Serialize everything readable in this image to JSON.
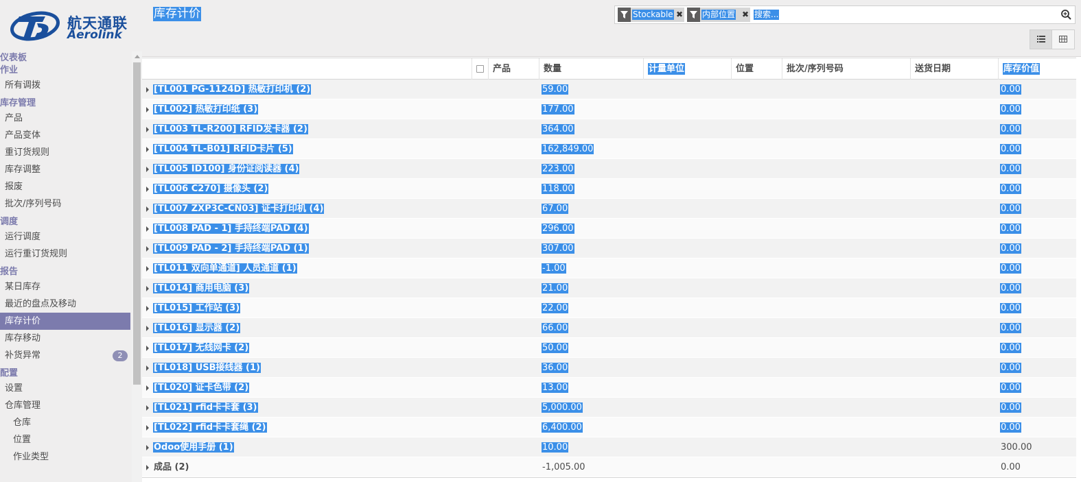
{
  "brand": {
    "name_cn": "航天通联",
    "name_en": "Aerolink",
    "colors": {
      "logo": "#1a4f9c",
      "accent": "#7c7bad",
      "selection": "#3b8fe8"
    }
  },
  "sidebar": {
    "sections": [
      {
        "header": "仪表板",
        "items": []
      },
      {
        "header": "作业",
        "items": [
          {
            "label": "所有调拨"
          }
        ]
      },
      {
        "header": "库存管理",
        "items": [
          {
            "label": "产品"
          },
          {
            "label": "产品变体"
          },
          {
            "label": "重订货规则"
          },
          {
            "label": "库存调整"
          },
          {
            "label": "报废"
          },
          {
            "label": "批次/序列号码"
          }
        ]
      },
      {
        "header": "调度",
        "items": [
          {
            "label": "运行调度"
          },
          {
            "label": "运行重订货规则"
          }
        ]
      },
      {
        "header": "报告",
        "items": [
          {
            "label": "某日库存"
          },
          {
            "label": "最近的盘点及移动"
          },
          {
            "label": "库存计价"
          },
          {
            "label": "库存移动"
          },
          {
            "label": "补货异常",
            "badge": "2"
          }
        ]
      },
      {
        "header": "配置",
        "items": [
          {
            "label": "设置"
          },
          {
            "label": "仓库管理"
          },
          {
            "label": "仓库"
          },
          {
            "label": "位置"
          },
          {
            "label": "作业类型"
          }
        ]
      }
    ]
  },
  "control_panel": {
    "title": "库存计价",
    "search": {
      "facets": [
        {
          "label": "Stockable",
          "icon": "filter-icon"
        },
        {
          "label": "内部位置",
          "icon": "filter-icon"
        }
      ],
      "placeholder": "搜索..."
    },
    "views": [
      {
        "name": "list-view",
        "icon": "list-icon",
        "active": true
      },
      {
        "name": "pivot-view",
        "icon": "grid-icon",
        "active": false
      }
    ]
  },
  "table": {
    "columns": [
      "产品",
      "数量",
      "计量单位",
      "位置",
      "批次/序列号码",
      "送货日期",
      "库存价值"
    ],
    "rows": [
      {
        "name": "[TL001 PG-1124D] 热敏打印机 (2)",
        "quantity": "59.00",
        "value": "0.00"
      },
      {
        "name": "[TL002] 热敏打印纸 (3)",
        "quantity": "177.00",
        "value": "0.00"
      },
      {
        "name": "[TL003 TL-R200] RFID发卡器 (2)",
        "quantity": "364.00",
        "value": "0.00"
      },
      {
        "name": "[TL004 TL-B01] RFID卡片 (5)",
        "quantity": "162,849.00",
        "value": "0.00"
      },
      {
        "name": "[TL005 ID100] 身份证阅读器 (4)",
        "quantity": "223.00",
        "value": "0.00"
      },
      {
        "name": "[TL006 C270] 摄像头 (2)",
        "quantity": "118.00",
        "value": "0.00"
      },
      {
        "name": "[TL007 ZXP3C-CN03] 证卡打印机 (4)",
        "quantity": "67.00",
        "value": "0.00"
      },
      {
        "name": "[TL008 PAD - 1] 手持终端PAD (4)",
        "quantity": "296.00",
        "value": "0.00"
      },
      {
        "name": "[TL009 PAD - 2] 手持终端PAD (1)",
        "quantity": "307.00",
        "value": "0.00"
      },
      {
        "name": "[TL011 双向单通道] 人员通道 (1)",
        "quantity": "-1.00",
        "value": "0.00"
      },
      {
        "name": "[TL014] 商用电脑 (3)",
        "quantity": "21.00",
        "value": "0.00"
      },
      {
        "name": "[TL015] 工作站 (3)",
        "quantity": "22.00",
        "value": "0.00"
      },
      {
        "name": "[TL016] 显示器 (2)",
        "quantity": "66.00",
        "value": "0.00"
      },
      {
        "name": "[TL017] 无线网卡 (2)",
        "quantity": "50.00",
        "value": "0.00"
      },
      {
        "name": "[TL018] USB接线器 (1)",
        "quantity": "36.00",
        "value": "0.00"
      },
      {
        "name": "[TL020] 证卡色带 (2)",
        "quantity": "13.00",
        "value": "0.00"
      },
      {
        "name": "[TL021] rfid卡卡套 (3)",
        "quantity": "5,000.00",
        "value": "0.00"
      },
      {
        "name": "[TL022] rfid卡卡套绳 (2)",
        "quantity": "6,400.00",
        "value": "0.00"
      },
      {
        "name": "Odoo使用手册 (1)",
        "quantity": "10.00",
        "value": "300.00"
      },
      {
        "name": "成品 (2)",
        "quantity": "-1,005.00",
        "value": "0.00"
      }
    ]
  }
}
